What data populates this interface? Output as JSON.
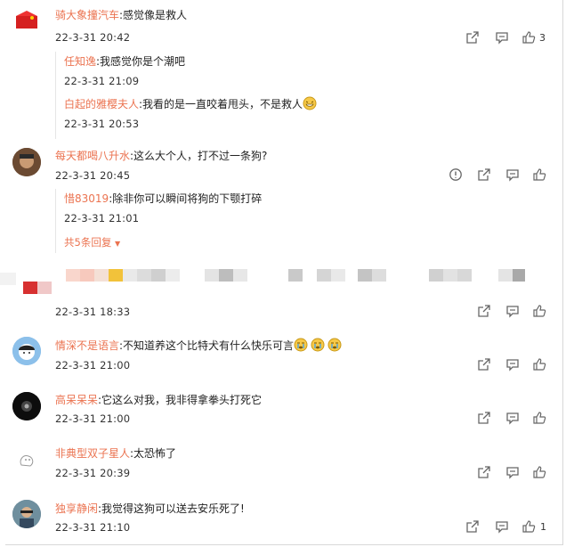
{
  "comments": [
    {
      "name": "骑大象撞汽车",
      "text": ":感觉像是救人",
      "time": "22-3-31 20:42",
      "likes": "3",
      "replies": [
        {
          "name": "任知逸",
          "text": ":我感觉你是个潮吧",
          "time": "22-3-31 21:09"
        },
        {
          "name": "白起的雅樱夫人",
          "text": ":我看的是一直咬着甩头，不是救人",
          "time": "22-3-31 20:53"
        }
      ]
    },
    {
      "name": "每天都喝八升水",
      "text": ":这么大个人，打不过一条狗?",
      "time": "22-3-31 20:45",
      "replies": [
        {
          "name": "惜83019",
          "text": ":除非你可以瞬间将狗的下颚打碎",
          "time": "22-3-31 21:01"
        }
      ],
      "more_replies": "共5条回复"
    },
    {
      "name": "",
      "text": "",
      "time": "22-3-31 18:33"
    },
    {
      "name": "情深不是语言",
      "text": ":不知道养这个比特犬有什么快乐可言",
      "time": "22-3-31 21:00"
    },
    {
      "name": "高呆呆呆",
      "text": ":它这么对我，我非得拿拳头打死它",
      "time": "22-3-31 21:00"
    },
    {
      "name": "非典型双子星人",
      "text": ":太恐怖了",
      "time": "22-3-31 20:39"
    },
    {
      "name": "独享静闲",
      "text": ":我觉得这狗可以送去安乐死了!",
      "time": "22-3-31 21:10",
      "likes": "1"
    }
  ],
  "colors": {
    "name": "#eb7350",
    "icon": "#666666"
  }
}
